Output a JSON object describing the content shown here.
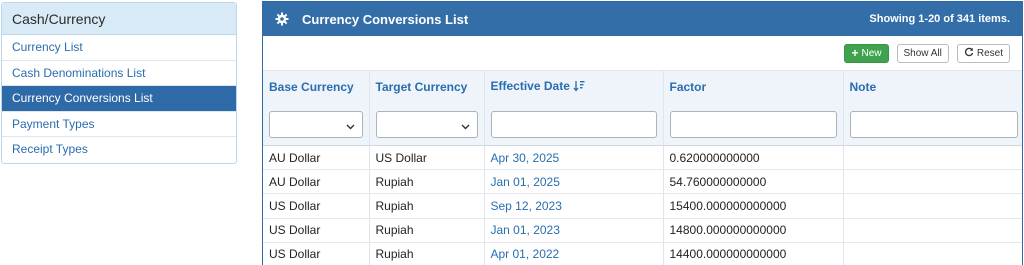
{
  "sidebar": {
    "title": "Cash/Currency",
    "items": [
      {
        "label": "Currency List",
        "active": false
      },
      {
        "label": "Cash Denominations List",
        "active": false
      },
      {
        "label": "Currency Conversions List",
        "active": true
      },
      {
        "label": "Payment Types",
        "active": false
      },
      {
        "label": "Receipt Types",
        "active": false
      }
    ]
  },
  "panel": {
    "title": "Currency Conversions List",
    "count_text": "Showing 1-20 of 341 items."
  },
  "toolbar": {
    "new_label": "New",
    "show_all_label": "Show All",
    "reset_label": "Reset"
  },
  "table": {
    "columns": [
      "Base Currency",
      "Target Currency",
      "Effective Date",
      "Factor",
      "Note"
    ],
    "rows": [
      [
        "AU Dollar",
        "US Dollar",
        "Apr 30, 2025",
        "0.620000000000",
        ""
      ],
      [
        "AU Dollar",
        "Rupiah",
        "Jan 01, 2025",
        "54.760000000000",
        ""
      ],
      [
        "US Dollar",
        "Rupiah",
        "Sep 12, 2023",
        "15400.000000000000",
        ""
      ],
      [
        "US Dollar",
        "Rupiah",
        "Jan 01, 2023",
        "14800.000000000000",
        ""
      ],
      [
        "US Dollar",
        "Rupiah",
        "Apr 01, 2022",
        "14400.000000000000",
        ""
      ]
    ]
  },
  "colors": {
    "header_blue": "#336ea9",
    "link_blue": "#2a6db0",
    "new_green": "#3fa34d"
  }
}
